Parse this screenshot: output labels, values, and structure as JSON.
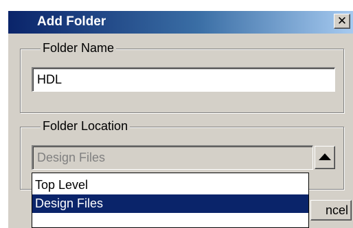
{
  "dialog": {
    "title": "Add Folder",
    "close_glyph": "✕"
  },
  "folder_name": {
    "legend": "Folder Name",
    "value": "HDL"
  },
  "folder_location": {
    "legend": "Folder Location",
    "selected": "Design Files",
    "options": [
      "Top Level",
      "Design Files"
    ],
    "highlighted_index": 1
  },
  "buttons": {
    "cancel_visible_text": "ncel"
  },
  "colors": {
    "title_start": "#0a246a",
    "title_end": "#a6caf0",
    "dialog_face": "#d4d0c8",
    "selection": "#0a246a"
  },
  "icons": {
    "close": "close-icon",
    "dropdown": "arrow-up-icon"
  }
}
